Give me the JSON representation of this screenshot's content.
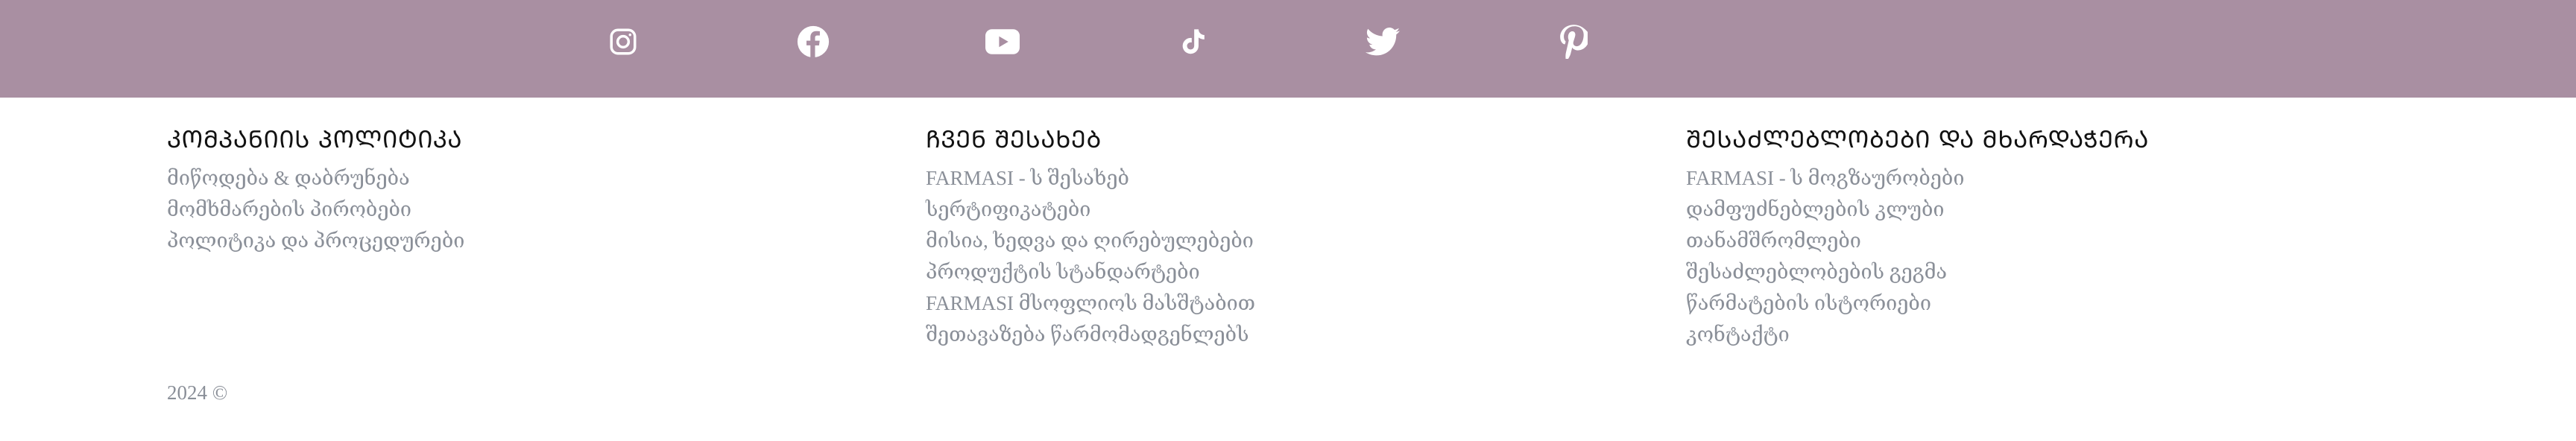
{
  "social": {
    "background_color": "#a98fa2",
    "icon_color": "#ffffff",
    "icons": [
      {
        "name": "instagram-icon"
      },
      {
        "name": "facebook-icon"
      },
      {
        "name": "youtube-icon"
      },
      {
        "name": "tiktok-icon"
      },
      {
        "name": "twitter-icon"
      },
      {
        "name": "pinterest-icon"
      }
    ]
  },
  "columns": [
    {
      "heading": "ᲙᲝᲛᲞᲐᲜᲘᲘᲡ ᲞᲝᲚᲘᲢᲘᲙᲐ",
      "links": [
        "მიწოდება & დაბრუნება",
        "მომხმარების პირობები",
        "პოლიტიკა და პროცედურები"
      ]
    },
    {
      "heading": "ᲩᲕᲔᲜ ᲨᲔᲡᲐᲮᲔᲑ",
      "links": [
        "FARMASI - ს შესახებ",
        "სერტიფიკატები",
        "მისია, ხედვა და ღირებულებები",
        "პროდუქტის სტანდარტები",
        "FARMASI მსოფლიოს მასშტაბით",
        "შეთავაზება წარმომადგენლებს"
      ]
    },
    {
      "heading": "ᲨᲔᲡᲐᲫᲚᲔᲑᲚᲝᲑᲔᲑᲘ ᲓᲐ ᲛᲮᲐᲠᲓᲐᲭᲔᲠᲐ",
      "links": [
        "FARMASI - ს მოგზაურობები",
        "დამფუძნებლების კლუბი",
        "თანამშრომლები",
        "შესაძლებლობების გეგმა",
        "წარმატების ისტორიები",
        "კონტაქტი"
      ]
    }
  ],
  "copyright": "2024 ©"
}
